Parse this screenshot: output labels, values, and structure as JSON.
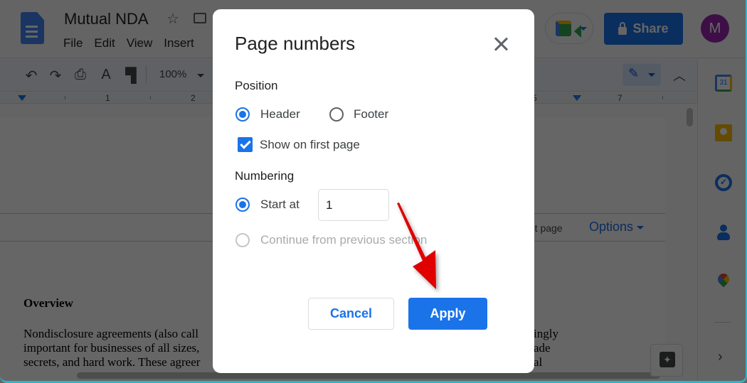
{
  "app": {
    "doc_title": "Mutual NDA",
    "menu": [
      "File",
      "Edit",
      "View",
      "Insert"
    ],
    "share_label": "Share",
    "avatar_initial": "M",
    "zoom": "100%",
    "ruler_numbers": [
      "1",
      "2",
      "5",
      "7"
    ],
    "header_text_partial": "rst page",
    "options_label": "Options",
    "calendar_day": "31"
  },
  "document": {
    "heading": "Overview",
    "paragraph_lines": [
      "Nondisclosure agreements (also call",
      "important for businesses of all sizes,",
      "secrets, and hard work. These agreer"
    ],
    "right_fragments": [
      "ingly",
      "ade",
      "al"
    ]
  },
  "dialog": {
    "title": "Page numbers",
    "position": {
      "label": "Position",
      "options": [
        {
          "label": "Header",
          "selected": true
        },
        {
          "label": "Footer",
          "selected": false
        }
      ],
      "show_first_page": {
        "label": "Show on first page",
        "checked": true
      }
    },
    "numbering": {
      "label": "Numbering",
      "start_at_label": "Start at",
      "start_at_value": "1",
      "continue_label": "Continue from previous section",
      "continue_disabled": true
    },
    "cancel_label": "Cancel",
    "apply_label": "Apply"
  },
  "colors": {
    "accent": "#1a73e8",
    "annotation_arrow": "#e00000"
  }
}
